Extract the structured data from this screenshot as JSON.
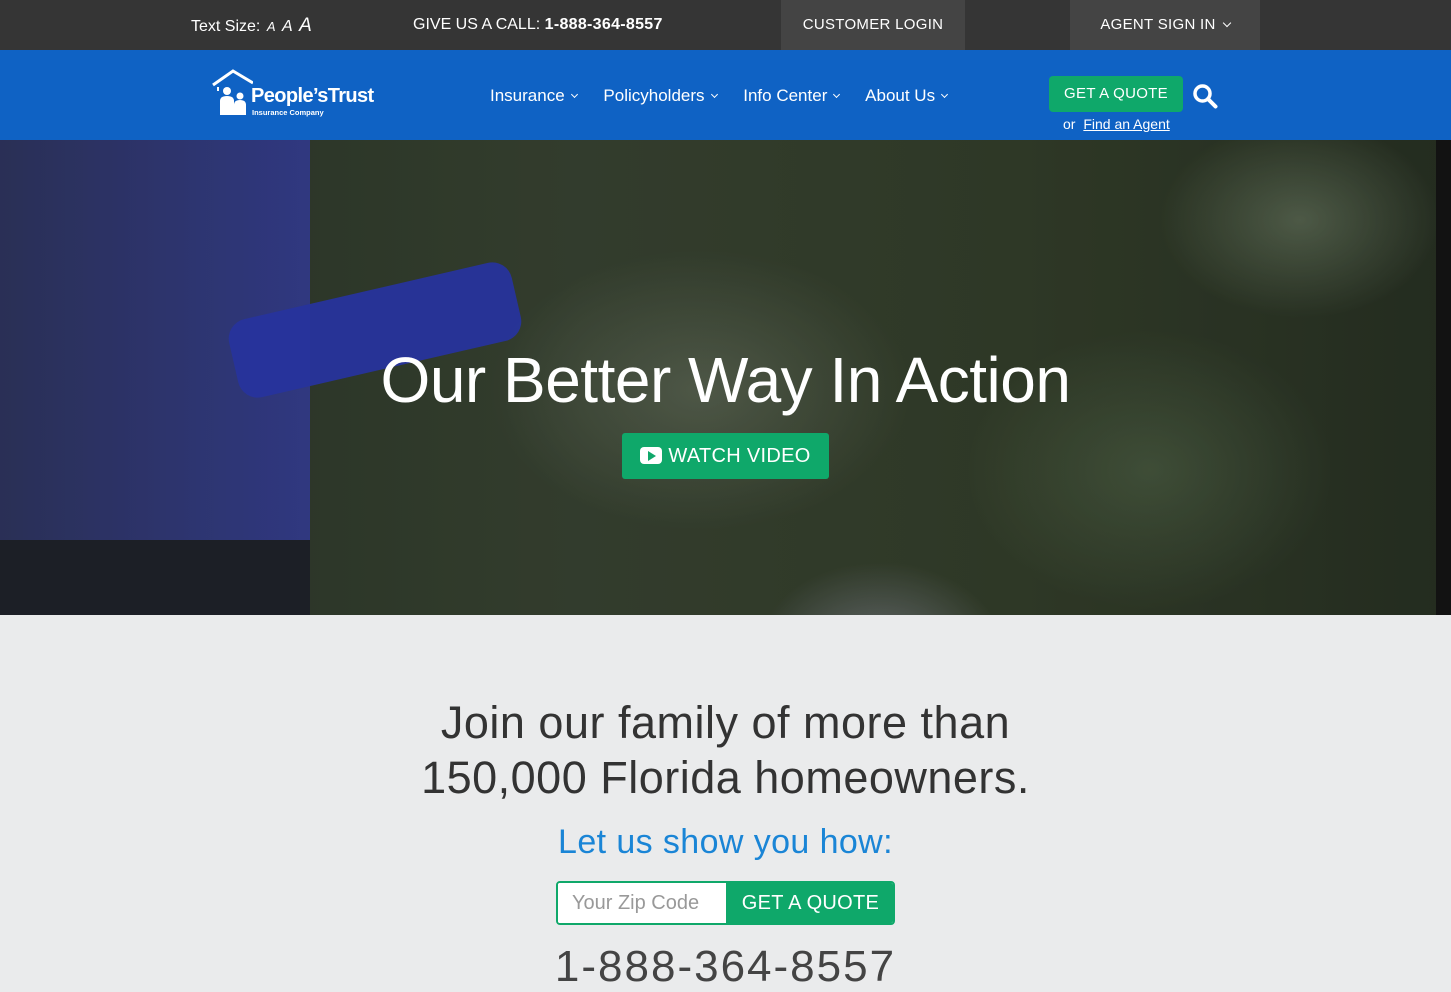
{
  "topbar": {
    "text_size_label": "Text Size:",
    "text_size_options": [
      "A",
      "A",
      "A"
    ],
    "call_label": "GIVE US A CALL:",
    "call_number": "1-888-364-8557",
    "customer_login": "CUSTOMER LOGIN",
    "agent_sign_in": "AGENT SIGN IN"
  },
  "nav": {
    "logo_name": "People’sTrust",
    "logo_sub": "Insurance Company",
    "items": [
      {
        "label": "Insurance"
      },
      {
        "label": "Policyholders"
      },
      {
        "label": "Info Center"
      },
      {
        "label": "About Us"
      }
    ],
    "quote_button": "GET A QUOTE",
    "or": "or",
    "find_agent": "Find an Agent"
  },
  "hero": {
    "headline": "Our Better Way In Action",
    "watch_video": "WATCH VIDEO"
  },
  "cta": {
    "join_line1": "Join our family of more than",
    "join_line2": "150,000 Florida homeowners.",
    "show_you": "Let us show you how:",
    "zip_placeholder": "Your Zip Code",
    "quote_button": "GET A QUOTE",
    "phone": "1-888-364-8557"
  },
  "colors": {
    "topbar": "#353535",
    "nav_blue": "#0f62c4",
    "accent_green": "#0fa86a",
    "link_blue": "#1a85d6"
  },
  "icons": [
    "house-logo-icon",
    "chevron-down-icon",
    "search-icon",
    "play-icon"
  ]
}
